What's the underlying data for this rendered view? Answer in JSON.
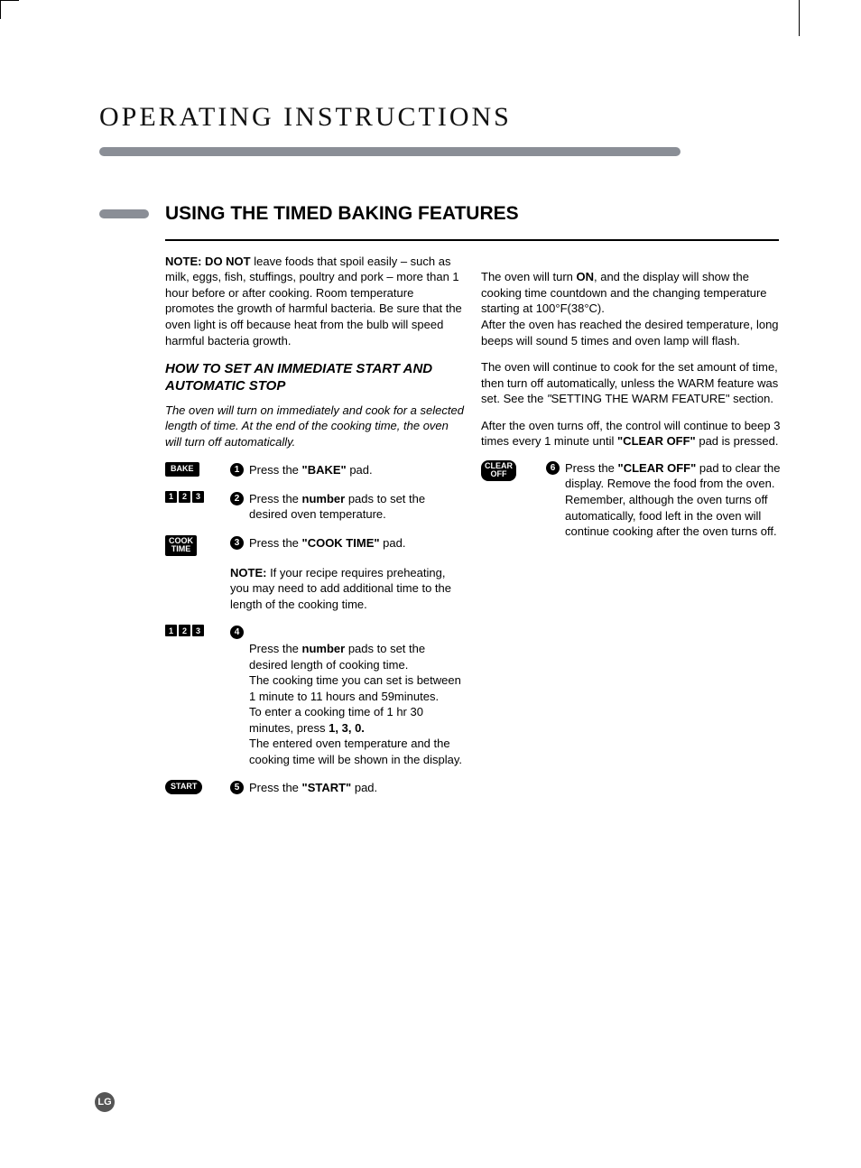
{
  "header_title": "OPERATING INSTRUCTIONS",
  "section_title": "USING THE TIMED BAKING FEATURES",
  "note_label": "NOTE: DO NOT",
  "note_body": " leave foods that spoil easily – such as milk, eggs, fish, stuffings, poultry and pork – more than 1 hour before or after cooking. Room temperature promotes the growth of harmful bacteria. Be sure that the oven light is off because heat from the bulb will speed harmful bacteria growth.",
  "sub_head": "HOW TO SET AN IMMEDIATE START AND AUTOMATIC STOP",
  "intro": "The oven will turn on immediately and cook for a selected length of time. At the end of the cooking time, the oven will turn off automatically.",
  "step1_pad": "BAKE",
  "step1_pre": "Press the ",
  "step1_bold": "\"BAKE\"",
  "step1_post": " pad.",
  "step2_pre": "Press the ",
  "step2_bold": "number",
  "step2_post": " pads to set the desired oven temperature.",
  "step3_pad": "COOK\nTIME",
  "step3_pre": "Press the ",
  "step3_bold": "\"COOK TIME\"",
  "step3_post": " pad.",
  "step3_note_label": "NOTE:",
  "step3_note_body": " If your recipe requires preheating, you may need to add additional time to the length of the cooking time.",
  "step4_pre": "Press the ",
  "step4_bold": "number",
  "step4_mid1": " pads to set the desired length of cooking time.\nThe cooking time you can set is between 1 minute to 11 hours and 59minutes.\nTo enter a cooking time of 1 hr 30 minutes, press ",
  "step4_bold2": "1, 3, 0.",
  "step4_mid2": "\nThe entered oven temperature and the cooking time will be shown in the display.",
  "step5_pad": "START",
  "step5_pre": "Press the ",
  "step5_bold": "\"START\"",
  "step5_post": " pad.",
  "r1a": "The oven will turn ",
  "r1b": "ON",
  "r1c": ", and the display will show the cooking time countdown and the changing temperature starting at 100°F(38°C).\nAfter the oven has reached the desired temperature, long beeps will sound 5 times and oven lamp will flash.",
  "r2a": "The oven will continue to cook for the set amount of time, then turn off automatically, unless the WARM feature was set. See the ",
  "r2b": "\"",
  "r2c": "SETTING THE WARM FEATURE\" section.",
  "r3a": "After the oven turns off, the control will continue to beep 3 times every 1 minute until ",
  "r3b": "\"CLEAR OFF\"",
  "r3c": " pad is pressed.",
  "step6_pad": "CLEAR\nOFF",
  "step6_pre": "Press the ",
  "step6_bold": "\"CLEAR OFF\"",
  "step6_post": " pad to clear the display. Remove the food from the oven. Remember, although the oven turns off automatically, food left in the oven will continue cooking after the oven turns off.",
  "logo": "LG"
}
